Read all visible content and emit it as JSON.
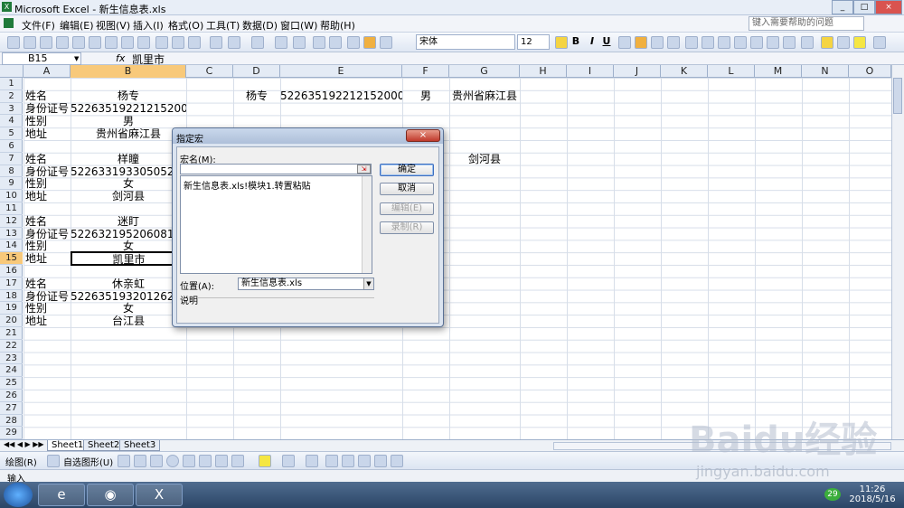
{
  "window": {
    "title": "Microsoft Excel - 新生信息表.xls",
    "min": "_",
    "max": "□",
    "close": "×"
  },
  "menu": {
    "items": [
      "文件(F)",
      "编辑(E)",
      "视图(V)",
      "插入(I)",
      "格式(O)",
      "工具(T)",
      "数据(D)",
      "窗口(W)",
      "帮助(H)"
    ],
    "help_placeholder": "键入需要帮助的问题"
  },
  "toolbar": {
    "font_name": "宋体",
    "font_size": "12",
    "bold": "B",
    "italic": "I",
    "underline": "U"
  },
  "formula_bar": {
    "name_box": "B15",
    "fx": "fx",
    "content": "凯里市"
  },
  "columns": [
    "A",
    "B",
    "C",
    "D",
    "E",
    "F",
    "G",
    "H",
    "I",
    "J",
    "K",
    "L",
    "M",
    "N",
    "O"
  ],
  "rows": [
    "1",
    "2",
    "3",
    "4",
    "5",
    "6",
    "7",
    "8",
    "9",
    "10",
    "11",
    "12",
    "13",
    "14",
    "15",
    "16",
    "17",
    "18",
    "19",
    "20",
    "21",
    "22",
    "23",
    "24",
    "25",
    "26",
    "27",
    "28",
    "29"
  ],
  "cells": {
    "A2": "姓名",
    "B2": "杨专",
    "D2": "杨专",
    "E2": "522635192212152000",
    "F2": "男",
    "G2": "贵州省麻江县",
    "A3": "身份证号",
    "B3": "522635192212152000",
    "A4": "性别",
    "B4": "男",
    "A5": "地址",
    "B5": "贵州省麻江县",
    "A7": "姓名",
    "B7": "样瞳",
    "G7": "剑河县",
    "A8": "身份证号",
    "B8": "522633193305052000",
    "A9": "性别",
    "B9": "女",
    "A10": "地址",
    "B10": "剑河县",
    "A12": "姓名",
    "B12": "迷盯",
    "A13": "身份证号",
    "B13": "522632195206081000",
    "A14": "性别",
    "B14": "女",
    "A15": "地址",
    "B15": "凯里市",
    "A17": "姓名",
    "B17": "休亲虹",
    "A18": "身份证号",
    "B18": "522635193201262000",
    "A19": "性别",
    "B19": "女",
    "A20": "地址",
    "B20": "台江县"
  },
  "sheets": [
    "Sheet1",
    "Sheet2",
    "Sheet3"
  ],
  "drawbar": {
    "draw": "绘图(R)",
    "autoshape": "自选图形(U)"
  },
  "status": "输入",
  "dialog": {
    "title": "指定宏",
    "macro_name_label": "宏名(M):",
    "macro_list": [
      "新生信息表.xls!模块1.转置粘贴"
    ],
    "ok": "确定",
    "cancel": "取消",
    "edit": "编辑(E)",
    "record": "录制(R)",
    "location_label": "位置(A):",
    "location_value": "新生信息表.xls",
    "description_label": "说明",
    "close": "×"
  },
  "taskbar": {
    "time": "11:26",
    "date": "2018/5/16",
    "badge": "29"
  },
  "watermark": {
    "logo": "Baidu经验",
    "url": "jingyan.baidu.com"
  }
}
